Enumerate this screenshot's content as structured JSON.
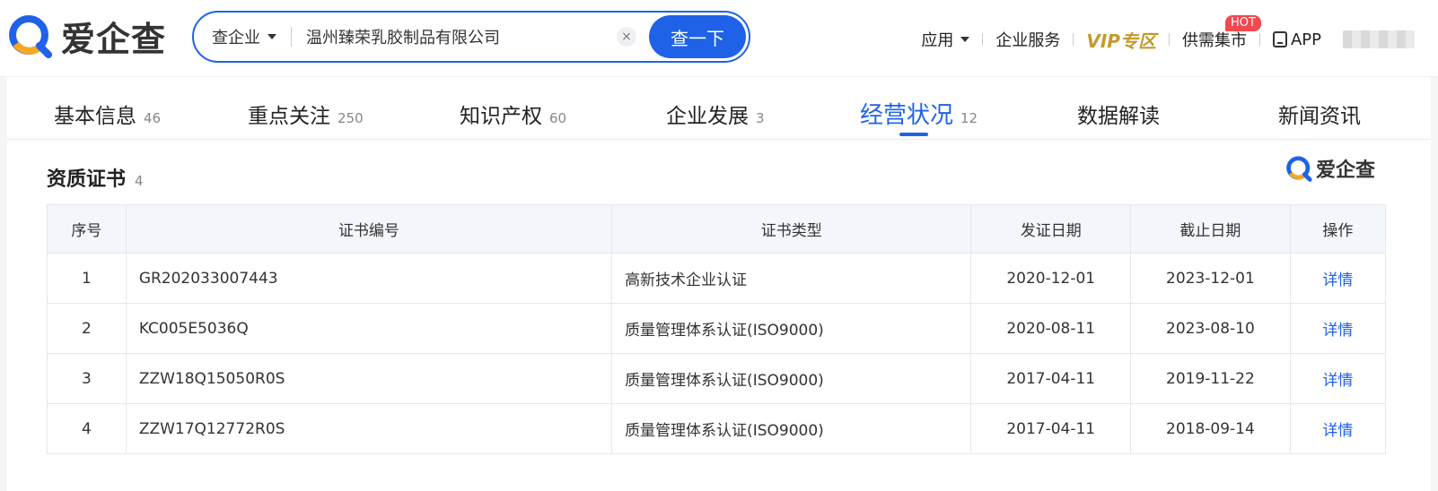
{
  "brand": {
    "name": "爱企查",
    "color": "#1f62e8"
  },
  "search": {
    "type_label": "查企业",
    "value": "温州臻荣乳胶制品有限公司",
    "clear_icon": "×",
    "button_label": "查一下"
  },
  "nav": {
    "app_label": "应用",
    "service_label": "企业服务",
    "vip_label": "VIP专区",
    "market_label": "供需集市",
    "hot_badge": "HOT",
    "app_download_label": "APP"
  },
  "tabs": [
    {
      "label": "基本信息",
      "count": "46"
    },
    {
      "label": "重点关注",
      "count": "250"
    },
    {
      "label": "知识产权",
      "count": "60"
    },
    {
      "label": "企业发展",
      "count": "3"
    },
    {
      "label": "经营状况",
      "count": "12"
    },
    {
      "label": "数据解读",
      "count": ""
    },
    {
      "label": "新闻资讯",
      "count": ""
    }
  ],
  "section": {
    "title": "资质证书",
    "count": "4",
    "watermark": "爱企查"
  },
  "table": {
    "headers": [
      "序号",
      "证书编号",
      "证书类型",
      "发证日期",
      "截止日期",
      "操作"
    ],
    "rows": [
      [
        "1",
        "GR202033007443",
        "高新技术企业认证",
        "2020-12-01",
        "2023-12-01",
        "详情"
      ],
      [
        "2",
        "KC005E5036Q",
        "质量管理体系认证(ISO9000)",
        "2020-08-11",
        "2023-08-10",
        "详情"
      ],
      [
        "3",
        "ZZW18Q15050R0S",
        "质量管理体系认证(ISO9000)",
        "2017-04-11",
        "2019-11-22",
        "详情"
      ],
      [
        "4",
        "ZZW17Q12772R0S",
        "质量管理体系认证(ISO9000)",
        "2017-04-11",
        "2018-09-14",
        "详情"
      ]
    ]
  }
}
